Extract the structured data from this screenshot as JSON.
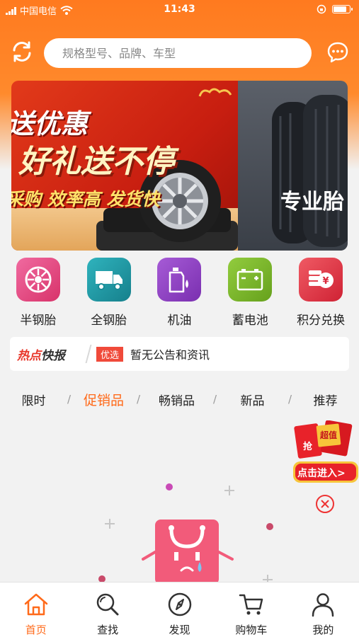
{
  "status_bar": {
    "carrier": "中国电信",
    "time": "11:43"
  },
  "search": {
    "placeholder": "规格型号、品牌、车型"
  },
  "banner": {
    "slide1": {
      "line1": "送优惠",
      "line2": "好礼送不停",
      "line3": "采购 效率高 发货快"
    },
    "slide2": {
      "line1": "专业胎"
    }
  },
  "categories": [
    {
      "label": "半钢胎",
      "icon": "wheel-icon",
      "color": "#e8467c"
    },
    {
      "label": "全钢胎",
      "icon": "truck-icon",
      "color": "#1e9aa6"
    },
    {
      "label": "机油",
      "icon": "oil-bottle-icon",
      "color": "#8e3fc4"
    },
    {
      "label": "蓄电池",
      "icon": "battery-icon",
      "color": "#7cbb2e"
    },
    {
      "label": "积分兑换",
      "icon": "points-exchange-icon",
      "color": "#e83b4a"
    }
  ],
  "news": {
    "title_hot": "热点",
    "title_quick": "快报",
    "tag": "优选",
    "text": "暂无公告和资讯"
  },
  "tabs": [
    {
      "label": "限时",
      "active": false
    },
    {
      "label": "促销品",
      "active": true
    },
    {
      "label": "畅销品",
      "active": false
    },
    {
      "label": "新品",
      "active": false
    },
    {
      "label": "推荐",
      "active": false
    }
  ],
  "promo": {
    "grab": "抢",
    "value": "超值",
    "enter": "点击进入>"
  },
  "bottom_nav": [
    {
      "label": "首页",
      "icon": "home-icon",
      "active": true
    },
    {
      "label": "查找",
      "icon": "search-icon",
      "active": false
    },
    {
      "label": "发现",
      "icon": "compass-icon",
      "active": false
    },
    {
      "label": "购物车",
      "icon": "cart-icon",
      "active": false
    },
    {
      "label": "我的",
      "icon": "profile-icon",
      "active": false
    }
  ],
  "colors": {
    "accent": "#ff6a1a",
    "header": "#ff7a1f",
    "news_hot": "#e8362a"
  }
}
